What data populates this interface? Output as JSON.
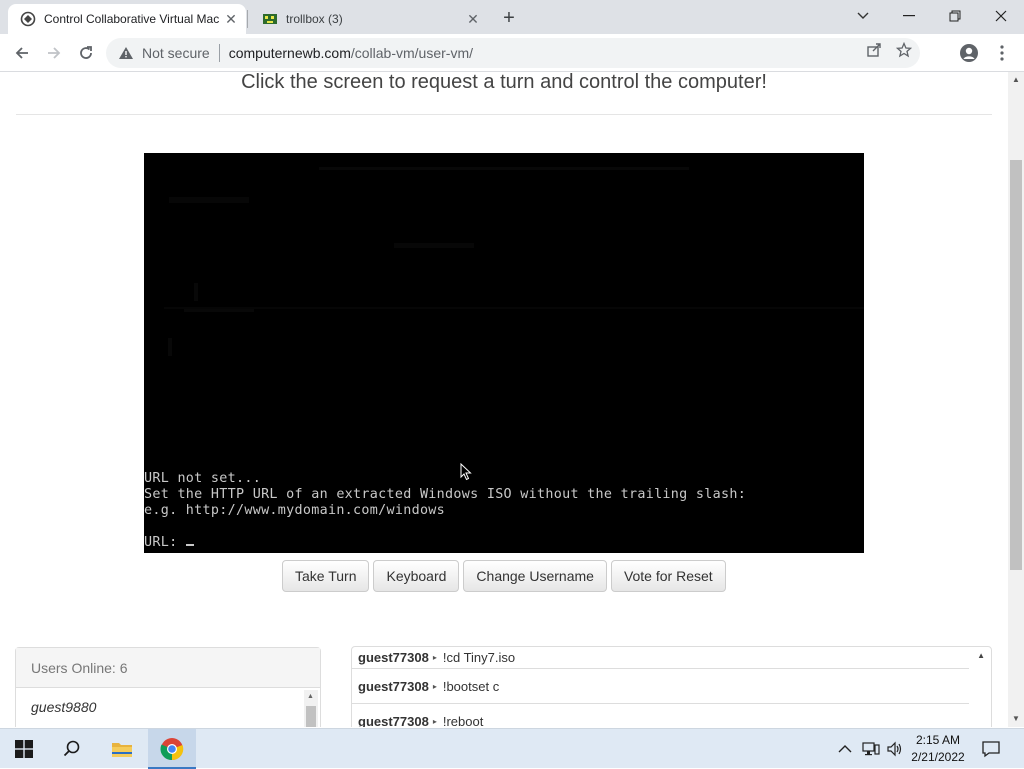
{
  "browser": {
    "tabs": [
      {
        "title": "Control Collaborative Virtual Machines",
        "active": true
      },
      {
        "title": "trollbox (3)",
        "active": false
      }
    ],
    "security_label": "Not secure",
    "url_host": "computernewb.com",
    "url_path": "/collab-vm/user-vm/"
  },
  "page": {
    "subtitle": "Click the screen to request a turn and control the computer!",
    "console_lines": [
      "URL not set...",
      "Set the HTTP URL of an extracted Windows ISO without the trailing slash:",
      "e.g. http://www.mydomain.com/windows",
      "",
      "URL: "
    ],
    "buttons": {
      "take_turn": "Take Turn",
      "keyboard": "Keyboard",
      "change_username": "Change Username",
      "vote_reset": "Vote for Reset"
    },
    "users": {
      "header": "Users Online: 6",
      "list": [
        "guest9880"
      ]
    },
    "chat": [
      {
        "user": "guest77308",
        "msg": "!cd Tiny7.iso"
      },
      {
        "user": "guest77308",
        "msg": "!bootset c"
      },
      {
        "user": "guest77308",
        "msg": "!reboot"
      }
    ]
  },
  "taskbar": {
    "time": "2:15 AM",
    "date": "2/21/2022"
  },
  "colors": {
    "tabstrip": "#dee1e6",
    "taskbar": "#dfe9f4",
    "vm_bg": "#000000"
  }
}
